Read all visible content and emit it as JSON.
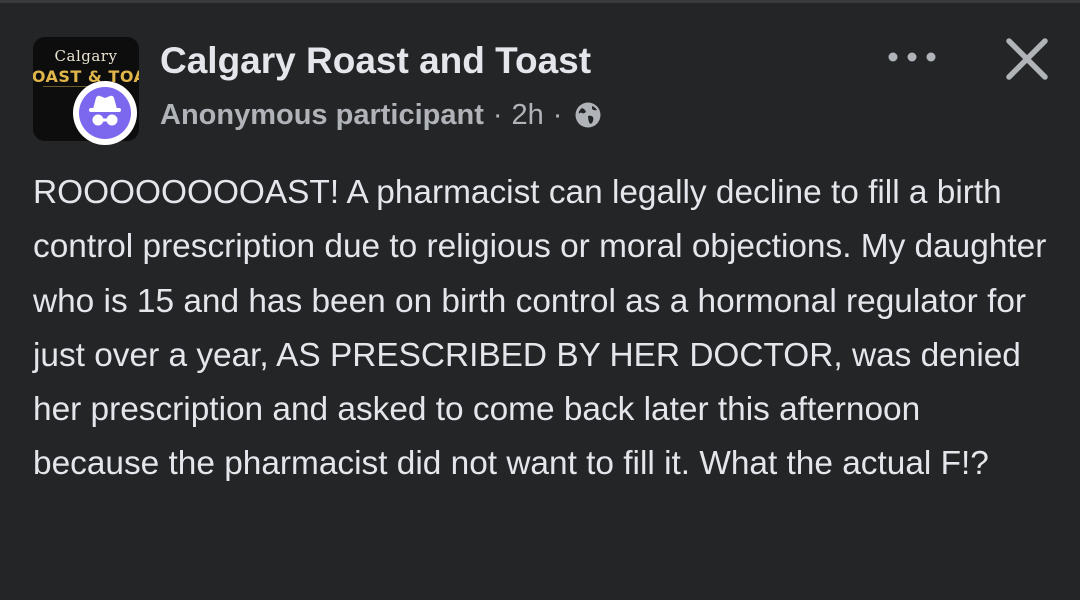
{
  "group": {
    "name": "Calgary Roast and Toast",
    "logo_top_text": "Calgary",
    "logo_main_text": "ROAST & TOAST"
  },
  "author": {
    "name": "Anonymous participant",
    "time": "2h",
    "separator": "·",
    "avatar_icon": "incognito-icon",
    "avatar_color": "#7b68ee"
  },
  "post": {
    "text": "ROOOOOOOOAST! A pharmacist can legally decline to fill a birth control prescription due to religious or moral objections. My daughter who is 15 and has been on birth control as a hormonal regulator for just over a year, AS PRESCRIBED BY HER DOCTOR, was denied her prescription and asked to come back later this afternoon because the pharmacist did not want to fill it. What the actual F!?"
  },
  "icons": {
    "privacy": "globe-icon",
    "more": "more-options-icon",
    "close": "close-icon"
  },
  "colors": {
    "background": "#242526",
    "primary_text": "#e4e6eb",
    "secondary_text": "#b0b3b8"
  }
}
